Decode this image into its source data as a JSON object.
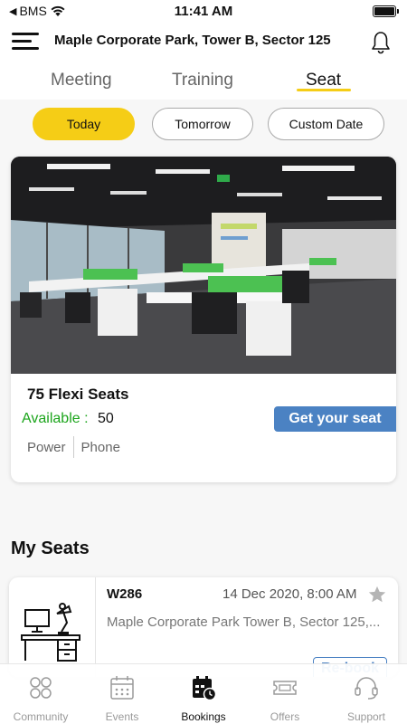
{
  "status_bar": {
    "carrier": "BMS",
    "time": "11:41 AM"
  },
  "header": {
    "title": "Maple Corporate Park, Tower B, Sector 125"
  },
  "tabs": [
    {
      "label": "Meeting",
      "active": false
    },
    {
      "label": "Training",
      "active": false
    },
    {
      "label": "Seat",
      "active": true
    }
  ],
  "date_filters": [
    {
      "label": "Today",
      "active": true
    },
    {
      "label": "Tomorrow",
      "active": false
    },
    {
      "label": "Custom Date",
      "active": false
    }
  ],
  "seat_offer": {
    "title": "75 Flexi Seats",
    "available_label": "Available :",
    "available_count": "50",
    "amenities": [
      "Power",
      "Phone"
    ],
    "cta_label": "Get your seat"
  },
  "my_seats": {
    "section_title": "My Seats",
    "bookings": [
      {
        "code": "W286",
        "datetime": "14 Dec 2020, 8:00 AM",
        "address": "Maple Corporate Park Tower B, Sector 125,...",
        "action_label": "Re-book"
      }
    ]
  },
  "bottom_nav": [
    {
      "label": "Community",
      "icon": "community-icon",
      "active": false
    },
    {
      "label": "Events",
      "icon": "calendar-icon",
      "active": false
    },
    {
      "label": "Bookings",
      "icon": "bookings-icon",
      "active": true
    },
    {
      "label": "Offers",
      "icon": "ticket-icon",
      "active": false
    },
    {
      "label": "Support",
      "icon": "headset-icon",
      "active": false
    }
  ],
  "colors": {
    "accent_yellow": "#f5cd16",
    "action_blue": "#4b82c3",
    "available_green": "#1ca51c",
    "divider_green": "#4cc152"
  }
}
